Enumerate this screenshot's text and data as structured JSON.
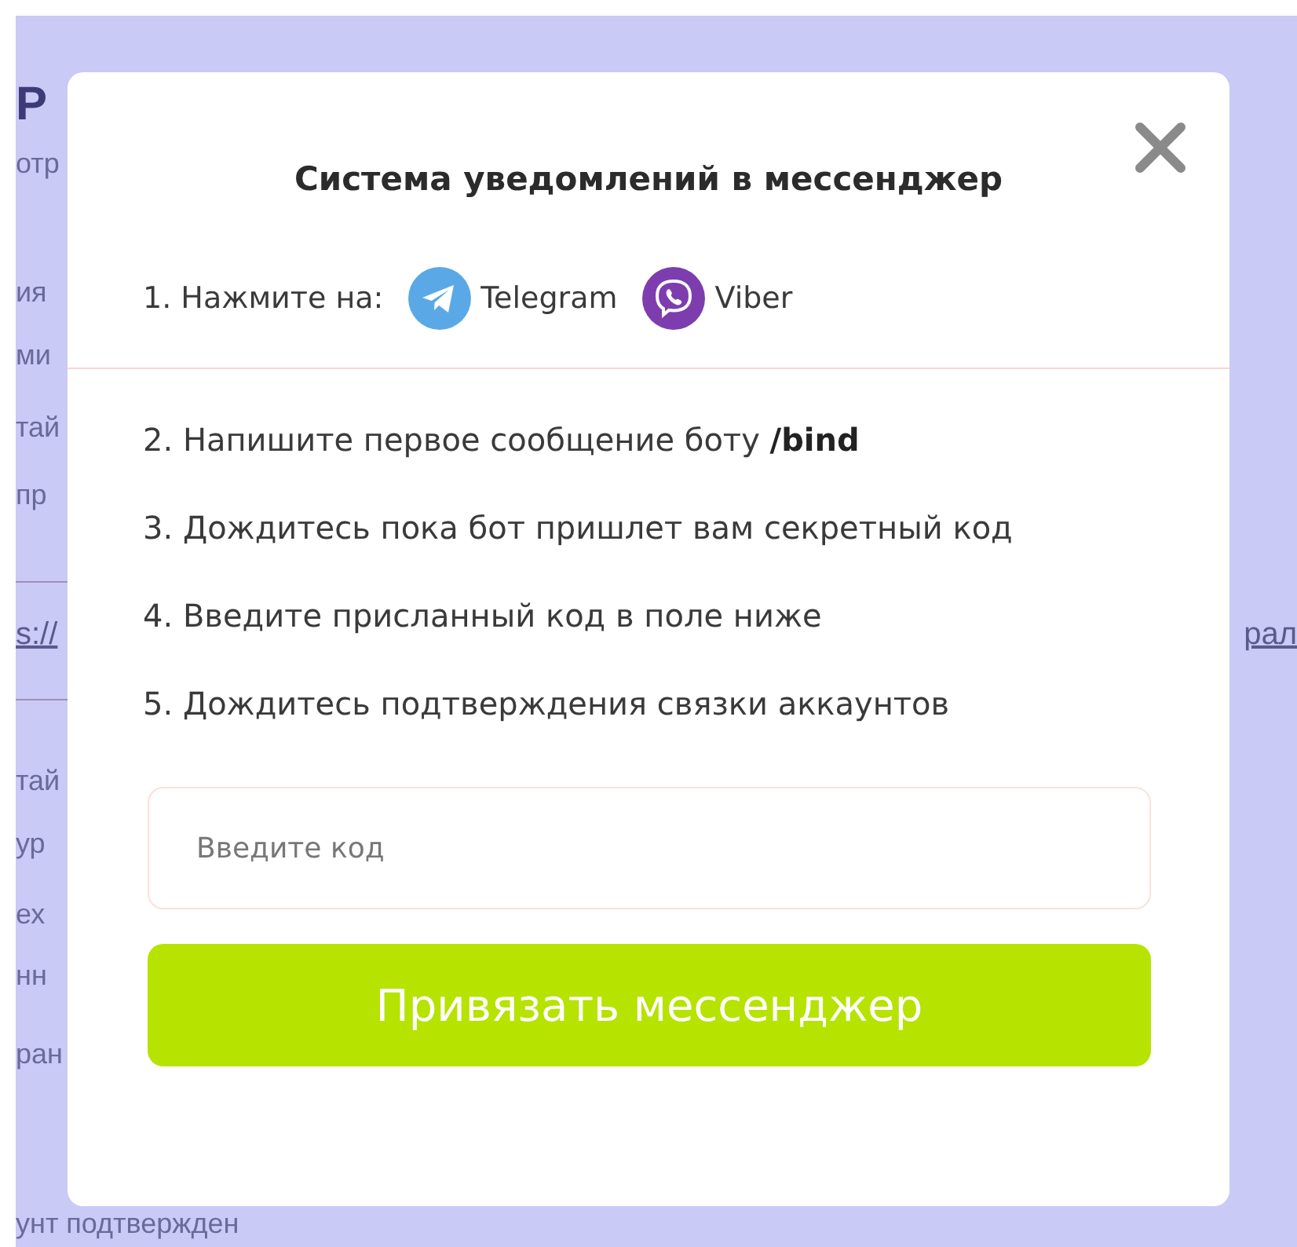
{
  "background": {
    "lines": [
      {
        "kind": "heading",
        "left": "Р"
      },
      {
        "kind": "text",
        "left": "отр"
      },
      {
        "kind": "text",
        "left": "ия"
      },
      {
        "kind": "text",
        "left": "ми"
      },
      {
        "kind": "text",
        "left": "тай"
      },
      {
        "kind": "text",
        "left": "пр"
      },
      {
        "kind": "link",
        "left": "s://",
        "right": "рал"
      },
      {
        "kind": "text",
        "left": "тай"
      },
      {
        "kind": "text",
        "left": "ур"
      },
      {
        "kind": "text",
        "left": "ех"
      },
      {
        "kind": "text",
        "left": "нн"
      },
      {
        "kind": "text",
        "left": "ран"
      },
      {
        "kind": "text",
        "left": "унт подтвержден"
      }
    ]
  },
  "dialog": {
    "title": "Система уведомлений в мессенджер",
    "step1": {
      "label": "1. Нажмите на:",
      "messengers": [
        {
          "kind": "telegram",
          "name": "Telegram"
        },
        {
          "kind": "viber",
          "name": "Viber"
        }
      ]
    },
    "steps": [
      "2. Напишите первое сообщение боту **/bind**",
      "3. Дождитесь пока бот пришлет вам секретный код",
      "4. Введите присланный код в поле ниже",
      "5. Дождитесь подтверждения связки аккаунтов"
    ],
    "code_field": {
      "placeholder": "Введите код"
    },
    "submit": "Привязать мессенджер"
  }
}
